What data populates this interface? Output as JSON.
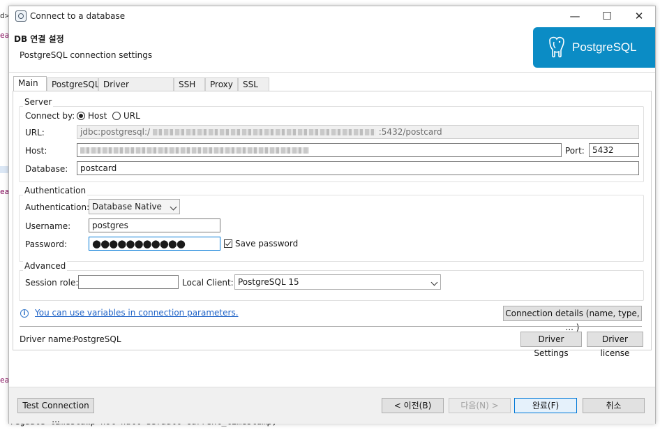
{
  "background": {
    "fragments": [
      "d>",
      "ea",
      "ea",
      "ea"
    ],
    "bottom_code": "regdate timestamp not null default current_timestamp,"
  },
  "window": {
    "title": "Connect to a database",
    "controls": {
      "minimize": "—",
      "maximize": "☐",
      "close": "✕"
    }
  },
  "header": {
    "title": "DB 연결 설정",
    "subtitle": "PostgreSQL connection settings",
    "logo_text": "PostgreSQL",
    "logo_color": "#0b8cc5"
  },
  "tabs": [
    {
      "label": "Main",
      "active": true
    },
    {
      "label": "PostgreSQL",
      "active": false
    },
    {
      "label": "Driver properties",
      "active": false
    },
    {
      "label": "SSH",
      "active": false
    },
    {
      "label": "Proxy",
      "active": false
    },
    {
      "label": "SSL",
      "active": false
    }
  ],
  "server": {
    "group_label": "Server",
    "connect_by_label": "Connect by:",
    "connect_by_options": [
      "Host",
      "URL"
    ],
    "connect_by_selected": "Host",
    "url_label": "URL:",
    "url_prefix": "jdbc:postgresql:/",
    "url_suffix": ":5432/postcard",
    "host_label": "Host:",
    "port_label": "Port:",
    "port_value": "5432",
    "database_label": "Database:",
    "database_value": "postcard"
  },
  "authentication": {
    "group_label": "Authentication",
    "auth_label": "Authentication:",
    "auth_value": "Database Native",
    "username_label": "Username:",
    "username_value": "postgres",
    "password_label": "Password:",
    "password_mask": "●●●●●●●●●●●",
    "save_password_label": "Save password",
    "save_password_checked": true
  },
  "advanced": {
    "group_label": "Advanced",
    "session_role_label": "Session role:",
    "session_role_value": "",
    "local_client_label": "Local Client:",
    "local_client_value": "PostgreSQL 15"
  },
  "info": {
    "icon": "i",
    "link_text": "You can use variables in connection parameters.",
    "details_button": "Connection details (name, type, ... )"
  },
  "driver": {
    "name_label": "Driver name:",
    "name_value": "PostgreSQL",
    "settings_button": "Driver Settings",
    "license_button": "Driver license"
  },
  "footer": {
    "test_button": "Test Connection ...",
    "back_button": "< 이전(B)",
    "next_button": "다음(N) >",
    "finish_button": "완료(F)",
    "cancel_button": "취소"
  }
}
